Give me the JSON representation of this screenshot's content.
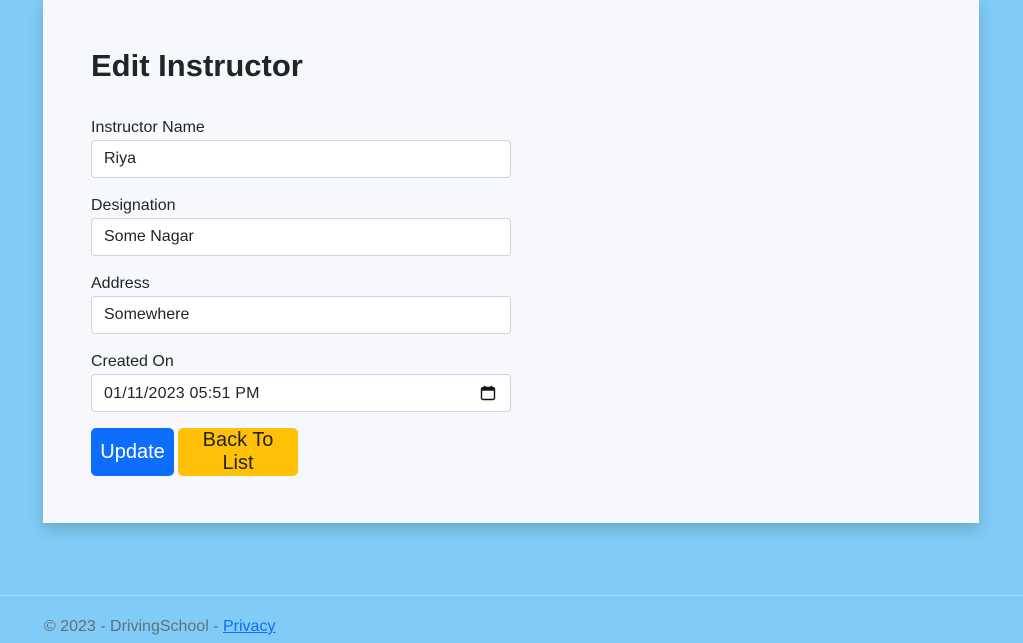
{
  "page": {
    "title": "Edit Instructor"
  },
  "form": {
    "instructor_name": {
      "label": "Instructor Name",
      "value": "Riya"
    },
    "designation": {
      "label": "Designation",
      "value": "Some Nagar"
    },
    "address": {
      "label": "Address",
      "value": "Somewhere"
    },
    "created_on": {
      "label": "Created On",
      "value": "01/11/2023 05:51 PM",
      "icon": "calendar-icon"
    }
  },
  "actions": {
    "update_label": "Update",
    "back_label": "Back To List"
  },
  "footer": {
    "text": "© 2023 - DrivingSchool - ",
    "privacy_label": "Privacy"
  },
  "colors": {
    "background": "#80ccf6",
    "card": "#f7f8fd",
    "primary": "#0d6efd",
    "warning": "#ffc107"
  }
}
